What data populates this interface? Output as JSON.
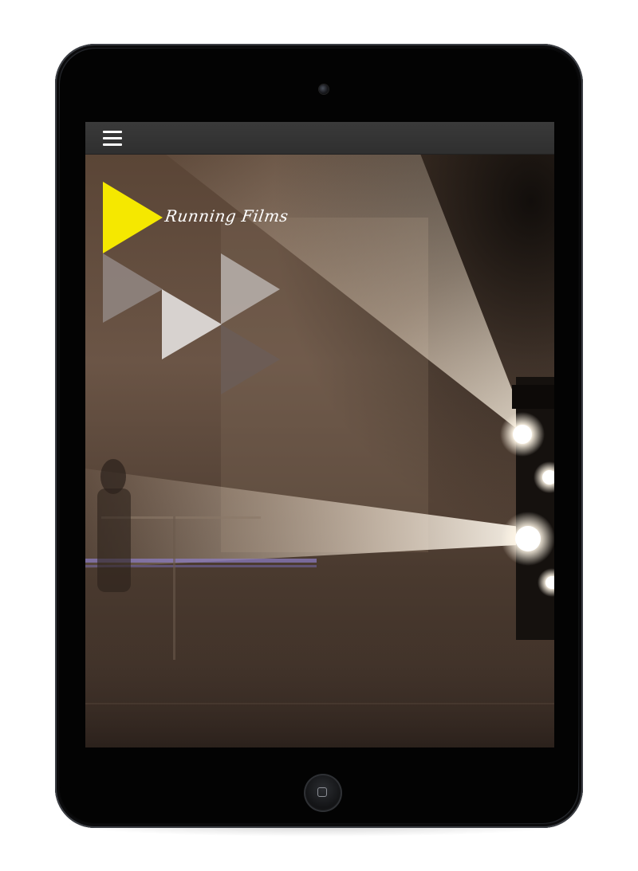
{
  "device": {
    "frame_color": "#050505",
    "home_button_icon": "home-square-icon",
    "camera_icon": "front-camera-icon"
  },
  "app": {
    "nav": {
      "menu_icon": "hamburger-menu-icon",
      "background": "#333333"
    },
    "logo": {
      "brand_name": "Running Films",
      "accent_color": "#f5e800",
      "triangle_colors": [
        "#8f8480",
        "#d7d2cf",
        "#b3aaa6",
        "#6b5d57"
      ]
    },
    "hero": {
      "image_subject": "stage-spotlights-image"
    }
  }
}
